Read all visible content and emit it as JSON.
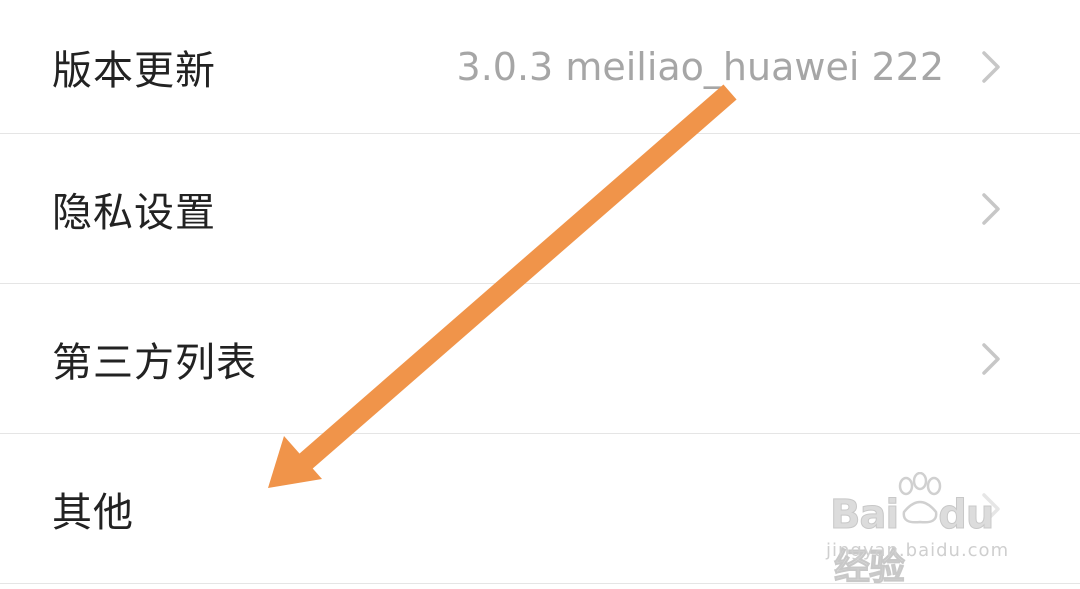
{
  "settings": {
    "items": [
      {
        "label": "版本更新",
        "value": "3.0.3 meiliao_huawei 222"
      },
      {
        "label": "隐私设置",
        "value": ""
      },
      {
        "label": "第三方列表",
        "value": ""
      },
      {
        "label": "其他",
        "value": ""
      }
    ]
  },
  "watermark": {
    "brand_left": "Bai",
    "brand_right": "du",
    "brand_cn": "经验",
    "subtitle": "jingyan.baidu.com"
  },
  "colors": {
    "arrow": "#f0944a",
    "label": "#222222",
    "value": "#a6a6a6",
    "chevron": "#c7c7c7",
    "divider": "#e5e5e5"
  }
}
